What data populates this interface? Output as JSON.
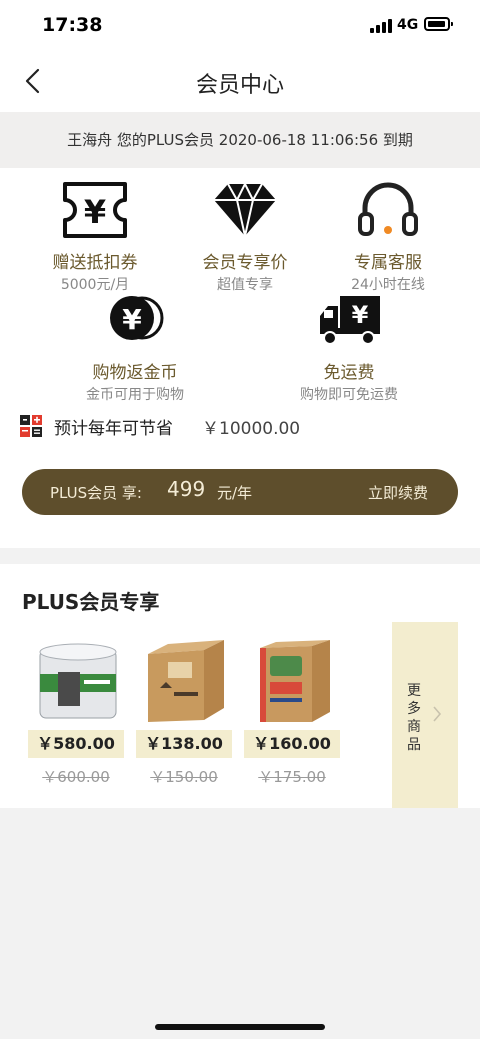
{
  "status_bar": {
    "time": "17:38",
    "network": "4G"
  },
  "nav": {
    "title": "会员中心"
  },
  "member_info": {
    "text": "王海舟 您的PLUS会员 2020-06-18 11:06:56 到期"
  },
  "benefits": [
    {
      "title": "赠送抵扣券",
      "subtitle": "5000元/月",
      "icon": "coupon-icon"
    },
    {
      "title": "会员专享价",
      "subtitle": "超值专享",
      "icon": "diamond-icon"
    },
    {
      "title": "专属客服",
      "subtitle": "24小时在线",
      "icon": "headset-icon"
    },
    {
      "title": "购物返金币",
      "subtitle": "金币可用于购物",
      "icon": "coins-icon"
    },
    {
      "title": "免运费",
      "subtitle": "购物即可免运费",
      "icon": "truck-icon"
    }
  ],
  "savings": {
    "label": "预计每年可节省",
    "value": "￥10000.00",
    "icon": "calculator-icon"
  },
  "plus_bar": {
    "label": "PLUS会员 享:",
    "price": "499",
    "unit": "元/年",
    "renew": "立即续费"
  },
  "exclusive": {
    "title": "PLUS会员专享",
    "products": [
      {
        "price": "￥580.00",
        "old_price": "￥600.00"
      },
      {
        "price": "￥138.00",
        "old_price": "￥150.00"
      },
      {
        "price": "￥160.00",
        "old_price": "￥175.00"
      }
    ],
    "more_label": "更多商品"
  },
  "colors": {
    "gold": "#5e4e2c",
    "accent_text": "#6b5a2e",
    "tag_bg": "#f3edcf",
    "orange_dot": "#f08a24"
  }
}
